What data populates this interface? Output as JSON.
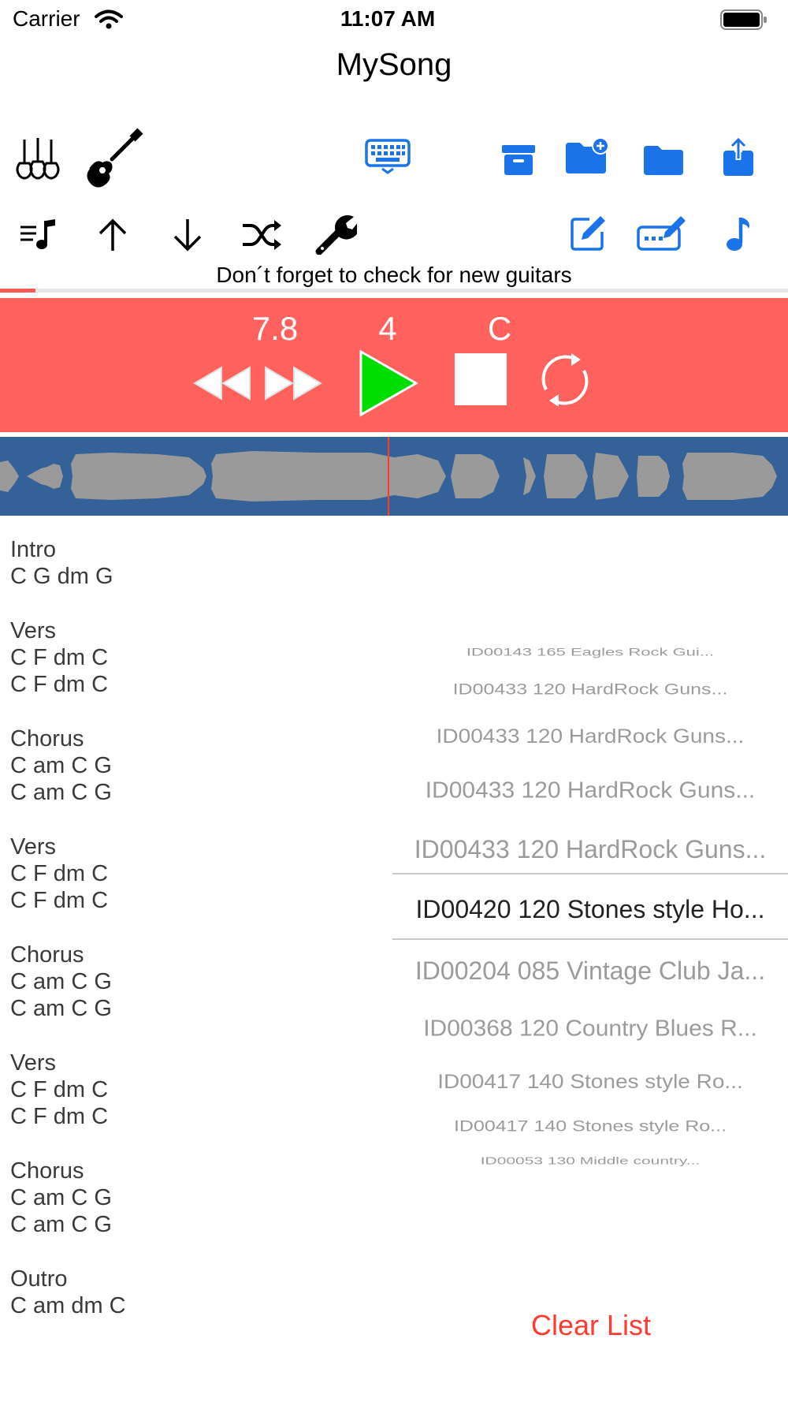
{
  "status_bar": {
    "carrier": "Carrier",
    "time": "11:07 AM"
  },
  "title": "MySong",
  "toolbar_top": {
    "icons": [
      "guitars-icon",
      "guitar-icon",
      "keyboard-icon",
      "archive-icon",
      "folder-add-icon",
      "folder-icon",
      "share-icon"
    ]
  },
  "toolbar_bottom": {
    "icons": [
      "playlist-icon",
      "arrow-up-icon",
      "arrow-down-icon",
      "shuffle-icon",
      "wrench-icon",
      "edit-icon",
      "keyboard-edit-icon",
      "music-note-icon"
    ]
  },
  "hint": "Don´t forget to check for new guitars",
  "progress": 0.045,
  "transport": {
    "tempo": "7.8",
    "beats": "4",
    "key": "C",
    "bg_color": "#ff615c",
    "play_color": "#00dd00"
  },
  "sections": [
    {
      "name": "Intro",
      "lines": [
        "C G dm G"
      ]
    },
    {
      "name": "Vers",
      "lines": [
        "C F dm C",
        "C F dm C"
      ]
    },
    {
      "name": "Chorus",
      "lines": [
        "C am C G",
        "C am C G"
      ]
    },
    {
      "name": "Vers",
      "lines": [
        "C F dm C",
        "C F dm C"
      ]
    },
    {
      "name": "Chorus",
      "lines": [
        "C am C G",
        "C am C G"
      ]
    },
    {
      "name": "Vers",
      "lines": [
        "C F dm C",
        "C F dm C"
      ]
    },
    {
      "name": "Chorus",
      "lines": [
        "C am C G",
        "C am C G"
      ]
    },
    {
      "name": "Outro",
      "lines": [
        "C am dm C"
      ]
    }
  ],
  "picker": {
    "items": [
      "ID00143 165 Eagles Rock Gui...",
      "ID00433 120 HardRock Guns...",
      "ID00433 120 HardRock Guns...",
      "ID00433 120 HardRock Guns...",
      "ID00433 120 HardRock Guns...",
      "ID00420 120 Stones style Ho...",
      "ID00204 085 Vintage Club Ja...",
      "ID00368 120 Country Blues R...",
      "ID00417 140 Stones style Ro...",
      "ID00417 140 Stones style Ro...",
      "ID00053 130 Middle country..."
    ],
    "selected_index": 5
  },
  "clear_button": "Clear List"
}
